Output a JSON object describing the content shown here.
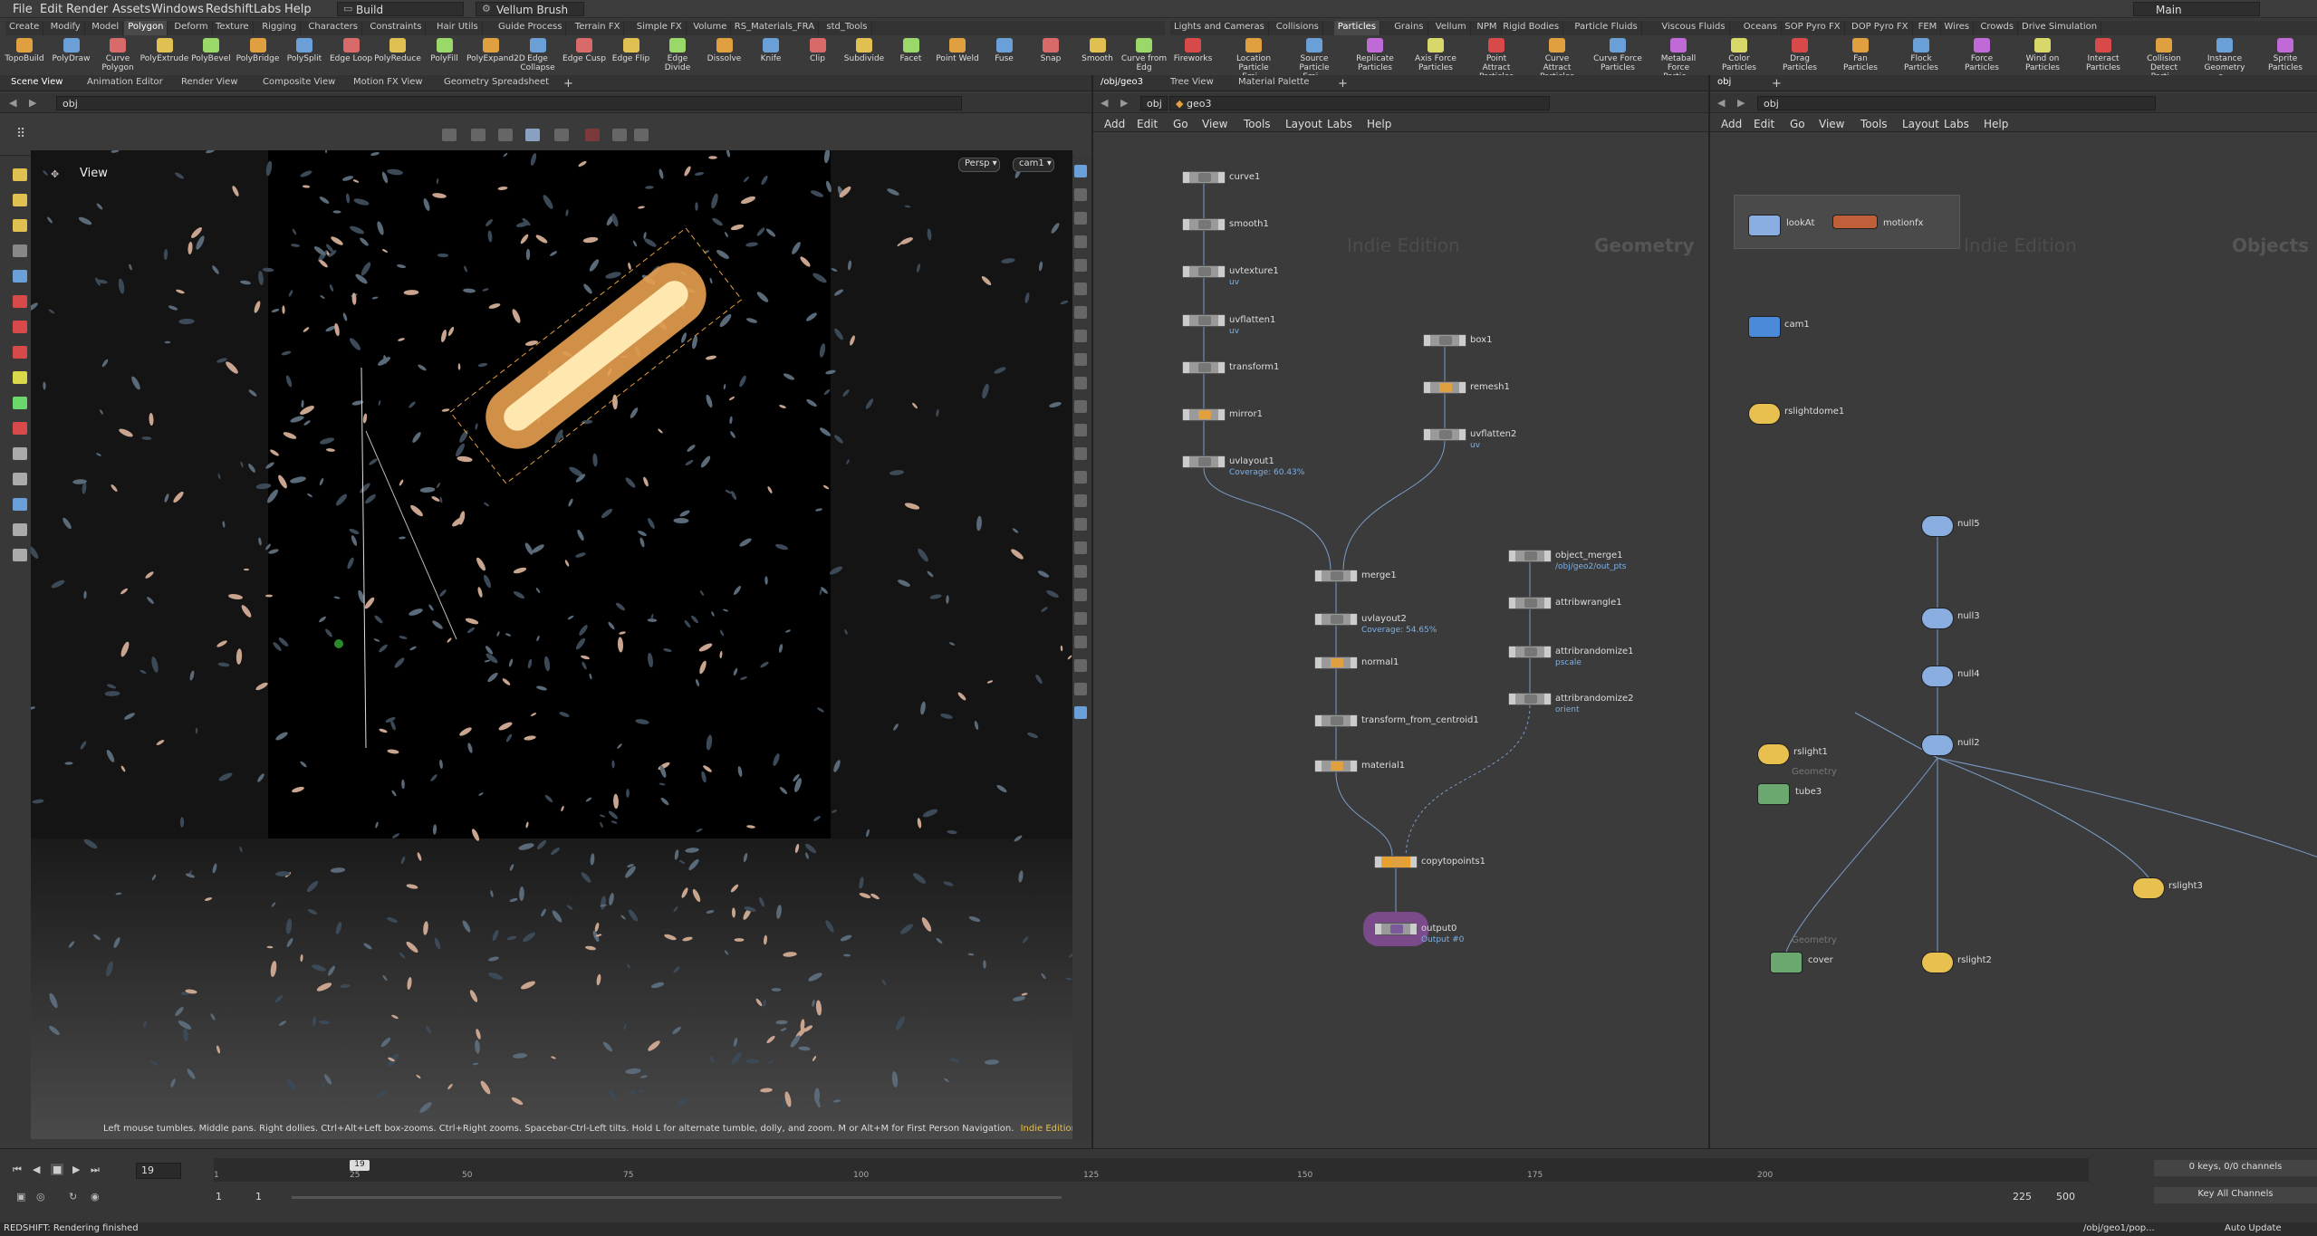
{
  "menubar": {
    "items": [
      "File",
      "Edit",
      "Render",
      "Assets",
      "Windows",
      "Redshift",
      "Labs",
      "Help"
    ],
    "desktop_left": "Build",
    "tool_center": "Vellum Brush",
    "desktop_right": "Main"
  },
  "shelf_left": {
    "tabs": [
      "Create",
      "Modify",
      "Model",
      "Polygon",
      "Deform",
      "Texture",
      "Rigging",
      "Characters",
      "Constraints",
      "Hair Utils",
      "Guide Process",
      "Terrain FX",
      "Simple FX",
      "Volume",
      "RS_Materials_FRA",
      "std_Tools"
    ],
    "active": "Polygon",
    "tools": [
      "TopoBuild",
      "PolyDraw",
      "Curve Polygon",
      "PolyExtrude",
      "PolyBevel",
      "PolyBridge",
      "PolySplit",
      "Edge Loop",
      "PolyReduce",
      "PolyFill",
      "PolyExpand2D",
      "Edge Collapse",
      "Edge Cusp",
      "Edge Flip",
      "Edge Divide",
      "Dissolve",
      "Knife",
      "Clip",
      "Subdivide",
      "Facet",
      "Point Weld",
      "Fuse",
      "Snap",
      "Smooth",
      "Curve from Edg"
    ]
  },
  "shelf_right": {
    "tabs": [
      "Lights and Cameras",
      "Collisions",
      "Particles",
      "Grains",
      "Vellum",
      "NPM",
      "Rigid Bodies",
      "Particle Fluids",
      "Viscous Fluids",
      "Oceans",
      "SOP Pyro FX",
      "DOP Pyro FX",
      "FEM",
      "Wires",
      "Crowds",
      "Drive Simulation"
    ],
    "active": "Particles",
    "tools": [
      "Fireworks",
      "Location Particle Emi...",
      "Source Particle Emi...",
      "Replicate Particles",
      "Axis Force Particles",
      "Point Attract Particles",
      "Curve Attract Particles",
      "Curve Force Particles",
      "Metaball Force Partic...",
      "Color Particles",
      "Drag Particles",
      "Fan Particles",
      "Flock Particles",
      "Force Particles",
      "Wind on Particles",
      "Interact Particles",
      "Collision Detect Parti...",
      "Instance Geometry o...",
      "Sprite Particles"
    ]
  },
  "viewer": {
    "tabs": [
      "Scene View",
      "Animation Editor",
      "Render View",
      "Composite View",
      "Motion FX View",
      "Geometry Spreadsheet"
    ],
    "path": "obj",
    "label": "View",
    "persp": "Persp",
    "cam": "cam1",
    "help": "Left mouse tumbles. Middle pans. Right dollies. Ctrl+Alt+Left box-zooms. Ctrl+Right zooms. Spacebar-Ctrl-Left tilts. Hold L for alternate tumble, dolly, and zoom. M or Alt+M for First Person Navigation.",
    "edition": "Indie Edition"
  },
  "net_mid": {
    "tabs": [
      "/obj/geo3",
      "Tree View",
      "Material Palette"
    ],
    "path_a": "obj",
    "path_b": "geo3",
    "menu": [
      "Add",
      "Edit",
      "Go",
      "View",
      "Tools",
      "Layout",
      "Labs",
      "Help"
    ],
    "watermark": "Indie Edition",
    "context": "Geometry",
    "nodes": [
      {
        "name": "curve1",
        "sub": ""
      },
      {
        "name": "smooth1",
        "sub": ""
      },
      {
        "name": "uvtexture1",
        "sub": "uv"
      },
      {
        "name": "uvflatten1",
        "sub": "uv"
      },
      {
        "name": "transform1",
        "sub": ""
      },
      {
        "name": "mirror1",
        "sub": ""
      },
      {
        "name": "uvlayout1",
        "sub": "Coverage: 60.43%"
      },
      {
        "name": "box1",
        "sub": ""
      },
      {
        "name": "remesh1",
        "sub": ""
      },
      {
        "name": "uvflatten2",
        "sub": "uv"
      },
      {
        "name": "merge1",
        "sub": ""
      },
      {
        "name": "uvlayout2",
        "sub": "Coverage: 54.65%"
      },
      {
        "name": "normal1",
        "sub": ""
      },
      {
        "name": "transform_from_centroid1",
        "sub": ""
      },
      {
        "name": "material1",
        "sub": ""
      },
      {
        "name": "object_merge1",
        "sub": "/obj/geo2/out_pts"
      },
      {
        "name": "attribwrangle1",
        "sub": ""
      },
      {
        "name": "attribrandomize1",
        "sub": "pscale"
      },
      {
        "name": "attribrandomize2",
        "sub": "orient"
      },
      {
        "name": "copytopoints1",
        "sub": ""
      },
      {
        "name": "output0",
        "sub": "Output #0"
      }
    ]
  },
  "net_right": {
    "path": "obj",
    "menu": [
      "Add",
      "Edit",
      "Go",
      "View",
      "Tools",
      "Layout",
      "Labs",
      "Help"
    ],
    "watermark": "Indie Edition",
    "context": "Objects",
    "nodes": [
      "lookAt",
      "motionfx",
      "cam1",
      "rslightdome1",
      "null5",
      "null3",
      "null4",
      "null2",
      "rslight1",
      "tube3",
      "cover",
      "rslight2",
      "rslight3"
    ],
    "geometry_label": "Geometry"
  },
  "timeline": {
    "frame": "19",
    "marker": "19",
    "ticks": [
      "1",
      "25",
      "50",
      "75",
      "100",
      "125",
      "150",
      "175",
      "200"
    ],
    "start": "1",
    "start2": "1",
    "end": "225",
    "end2": "500",
    "keys": "0 keys, 0/0 channels",
    "key_all": "Key All Channels"
  },
  "status": {
    "text": "REDSHIFT: Rendering finished",
    "path": "/obj/geo1/pop...",
    "update": "Auto Update"
  }
}
